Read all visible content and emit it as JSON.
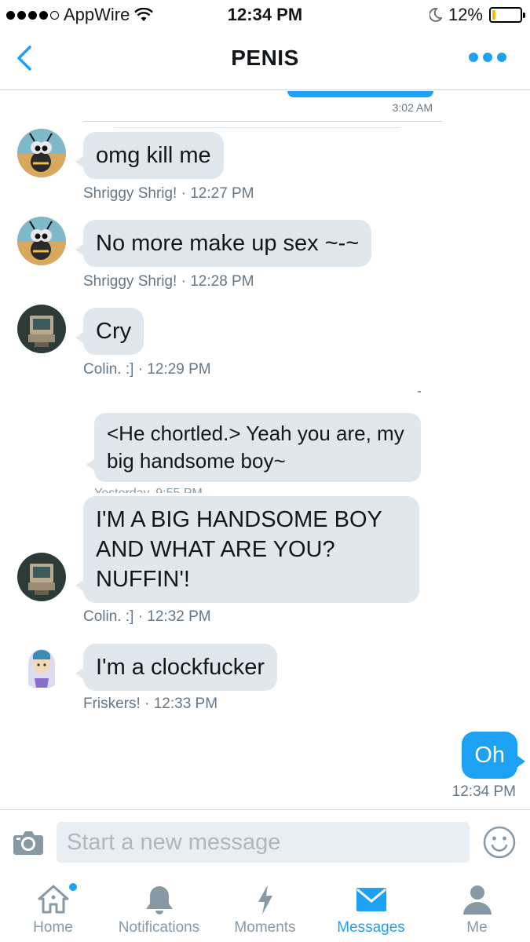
{
  "status_bar": {
    "carrier": "AppWire",
    "time": "12:34 PM",
    "battery": "12%",
    "battery_level": 0.12,
    "battery_color": "#f2c200"
  },
  "nav": {
    "title": "PENIS",
    "back_icon": "chevron-left-icon",
    "more_icon": "more-dots-icon"
  },
  "conversation": {
    "previous_time": "3:02 AM",
    "messages": [
      {
        "sender": "Shriggy Shrig!",
        "text": "omg kill me",
        "meta": "Shriggy Shrig! · 12:27 PM"
      },
      {
        "sender": "Shriggy Shrig!",
        "text": "No more make up sex ~-~",
        "meta": "Shriggy Shrig! · 12:28 PM"
      },
      {
        "sender": "Colin. :]",
        "text": "Cry",
        "meta": "Colin. :] · 12:29 PM"
      },
      {
        "sender": "Colin. :]",
        "text": "I'M A BIG HANDSOME BOY AND WHAT ARE YOU? NUFFIN'!",
        "meta": "Colin. :] · 12:32 PM"
      },
      {
        "sender": "Friskers!",
        "text": "I'm a clockfucker",
        "meta": "Friskers! · 12:33 PM"
      }
    ],
    "quoted": {
      "text": "<He chortled.> Yeah you are, my big handsome boy~",
      "meta": "Yesterday, 9:55 PM"
    },
    "outgoing": {
      "text": "Oh",
      "time": "12:34 PM"
    }
  },
  "composer": {
    "placeholder": "Start a new message",
    "value": ""
  },
  "tabs": [
    {
      "label": "Home",
      "icon": "home-icon",
      "active": false,
      "has_badge": true
    },
    {
      "label": "Notifications",
      "icon": "bell-icon",
      "active": false
    },
    {
      "label": "Moments",
      "icon": "lightning-icon",
      "active": false
    },
    {
      "label": "Messages",
      "icon": "envelope-icon",
      "active": true
    },
    {
      "label": "Me",
      "icon": "person-icon",
      "active": false
    }
  ],
  "colors": {
    "accent": "#1da1f2",
    "bubble_incoming": "#e1e8ed",
    "meta_text": "#657786",
    "inactive_tab": "#8899a6"
  }
}
